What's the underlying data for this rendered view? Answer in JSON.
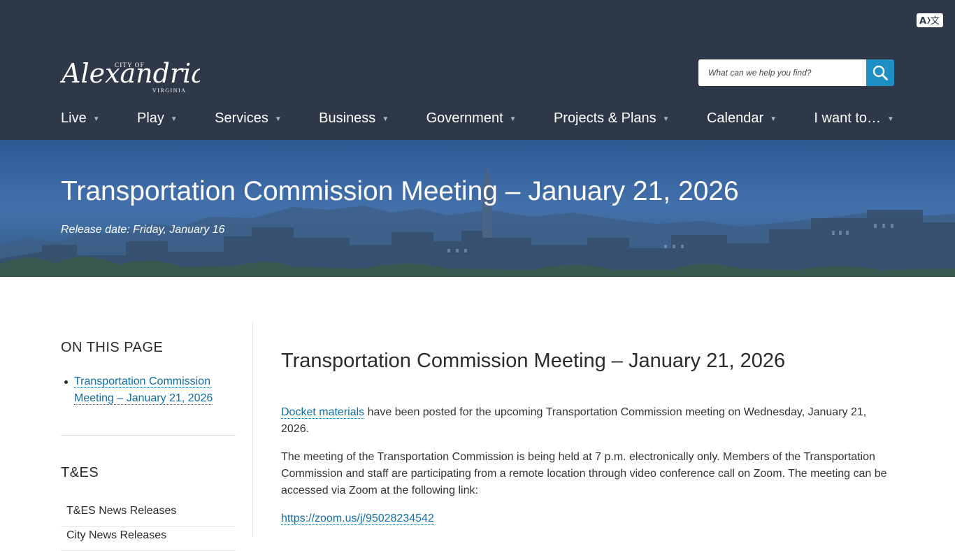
{
  "header": {
    "translate_label": "A文",
    "logo": {
      "line1": "CITY OF",
      "line2": "Alexandria",
      "line3": "VIRGINIA"
    },
    "search": {
      "placeholder": "What can we help you find?"
    },
    "nav": [
      {
        "label": "Live"
      },
      {
        "label": "Play"
      },
      {
        "label": "Services"
      },
      {
        "label": "Business"
      },
      {
        "label": "Government"
      },
      {
        "label": "Projects & Plans"
      },
      {
        "label": "Calendar"
      },
      {
        "label": "I want to…"
      }
    ],
    "nav_caret": "▼"
  },
  "hero": {
    "title": "Transportation Commission Meeting – January 21, 2026",
    "release_date": "Release date: Friday, January 16"
  },
  "sidebar": {
    "on_this_page_heading": "ON THIS PAGE",
    "on_this_page_links": [
      "Transportation Commission Meeting – January 21, 2026"
    ],
    "section_heading": "T&ES",
    "section_items": [
      "T&ES News Releases",
      "City News Releases"
    ]
  },
  "content": {
    "title": "Transportation Commission Meeting – January 21, 2026",
    "p1_link": "Docket materials",
    "p1_text": " have been posted for the upcoming Transportation Commission meeting on Wednesday, January 21, 2026.",
    "p2_text": "The meeting of the Transportation Commission is being held at 7 p.m. electronically only. Members of the Transportation Commission and staff are participating from a remote location through video conference call on Zoom. The meeting can be accessed via Zoom at the following link:",
    "zoom_link": "https://zoom.us/j/95028234542"
  },
  "colors": {
    "header_bg": "#2d3848",
    "search_button": "#1d8fc2",
    "link": "#0e6ea8",
    "hero_blue": "#3a67a3"
  }
}
